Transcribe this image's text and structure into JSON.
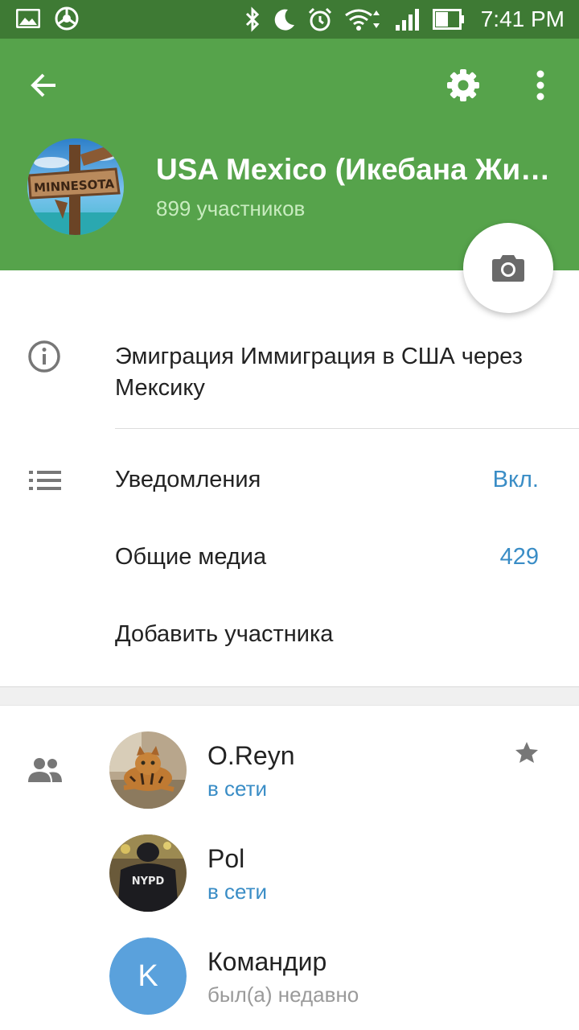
{
  "status_bar": {
    "time": "7:41 PM"
  },
  "header": {
    "title": "USA Mexico (Икебана Жи…",
    "subtitle": "899 участников",
    "avatar_text": "MINNESOTA"
  },
  "info": {
    "description": "Эмиграция Иммиграция в США через Мексику"
  },
  "rows": {
    "notifications_label": "Уведомления",
    "notifications_value": "Вкл.",
    "media_label": "Общие медиа",
    "media_value": "429",
    "add_member_label": "Добавить участника"
  },
  "members": [
    {
      "name": "O.Reyn",
      "status": "в сети",
      "avatar_text": ""
    },
    {
      "name": "Pol",
      "status": "в сети",
      "avatar_text": "NYPD"
    },
    {
      "name": "Командир",
      "status": "был(а) недавно",
      "avatar_letter": "K"
    }
  ],
  "colors": {
    "status_bar": "#3e7a34",
    "header": "#56a34b",
    "accent_blue": "#3a8dc6",
    "letter_avatar": "#5aa1dc"
  }
}
